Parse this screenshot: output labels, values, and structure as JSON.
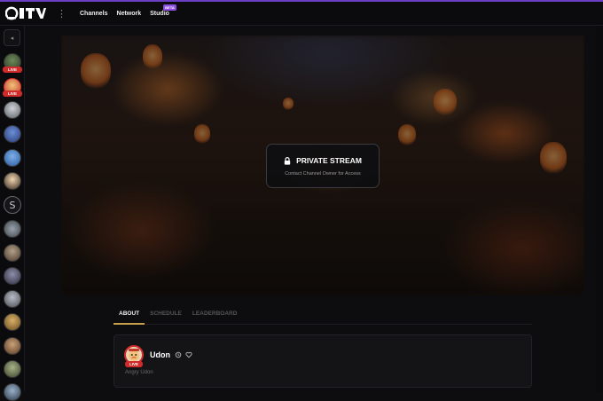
{
  "header": {
    "logo": "ITV",
    "nav": [
      {
        "label": "Channels"
      },
      {
        "label": "Network"
      },
      {
        "label": "Studio",
        "badge": "BETA"
      }
    ]
  },
  "sidebar": {
    "live_label": "LIVE",
    "channels": [
      {
        "icon": "channel-avatar",
        "live": true
      },
      {
        "icon": "channel-avatar",
        "live": true
      },
      {
        "icon": "channel-avatar",
        "live": false
      },
      {
        "icon": "channel-avatar",
        "live": false
      },
      {
        "icon": "channel-avatar",
        "live": false
      },
      {
        "icon": "channel-avatar",
        "live": false
      },
      {
        "icon": "channel-avatar",
        "live": false
      },
      {
        "icon": "channel-avatar",
        "live": false
      },
      {
        "icon": "channel-avatar",
        "live": false
      },
      {
        "icon": "channel-avatar",
        "live": false
      },
      {
        "icon": "channel-avatar",
        "live": false
      },
      {
        "icon": "channel-avatar",
        "live": false
      },
      {
        "icon": "channel-avatar",
        "live": false
      },
      {
        "icon": "channel-avatar",
        "live": false
      },
      {
        "icon": "channel-avatar",
        "live": false
      }
    ]
  },
  "player": {
    "title": "PRIVATE STREAM",
    "subtitle": "Contact Channel Owner for Access"
  },
  "tabs": [
    {
      "label": "ABOUT",
      "active": true
    },
    {
      "label": "SCHEDULE",
      "active": false
    },
    {
      "label": "LEADERBOARD",
      "active": false
    }
  ],
  "about": {
    "name": "Udon",
    "bio": "Angry Udon",
    "live_label": "LIVE"
  },
  "colors": {
    "accent": "#6a3fc4",
    "live": "#d02a2a",
    "tab_active": "#c9a04a",
    "beta": "#8e4fe0"
  }
}
